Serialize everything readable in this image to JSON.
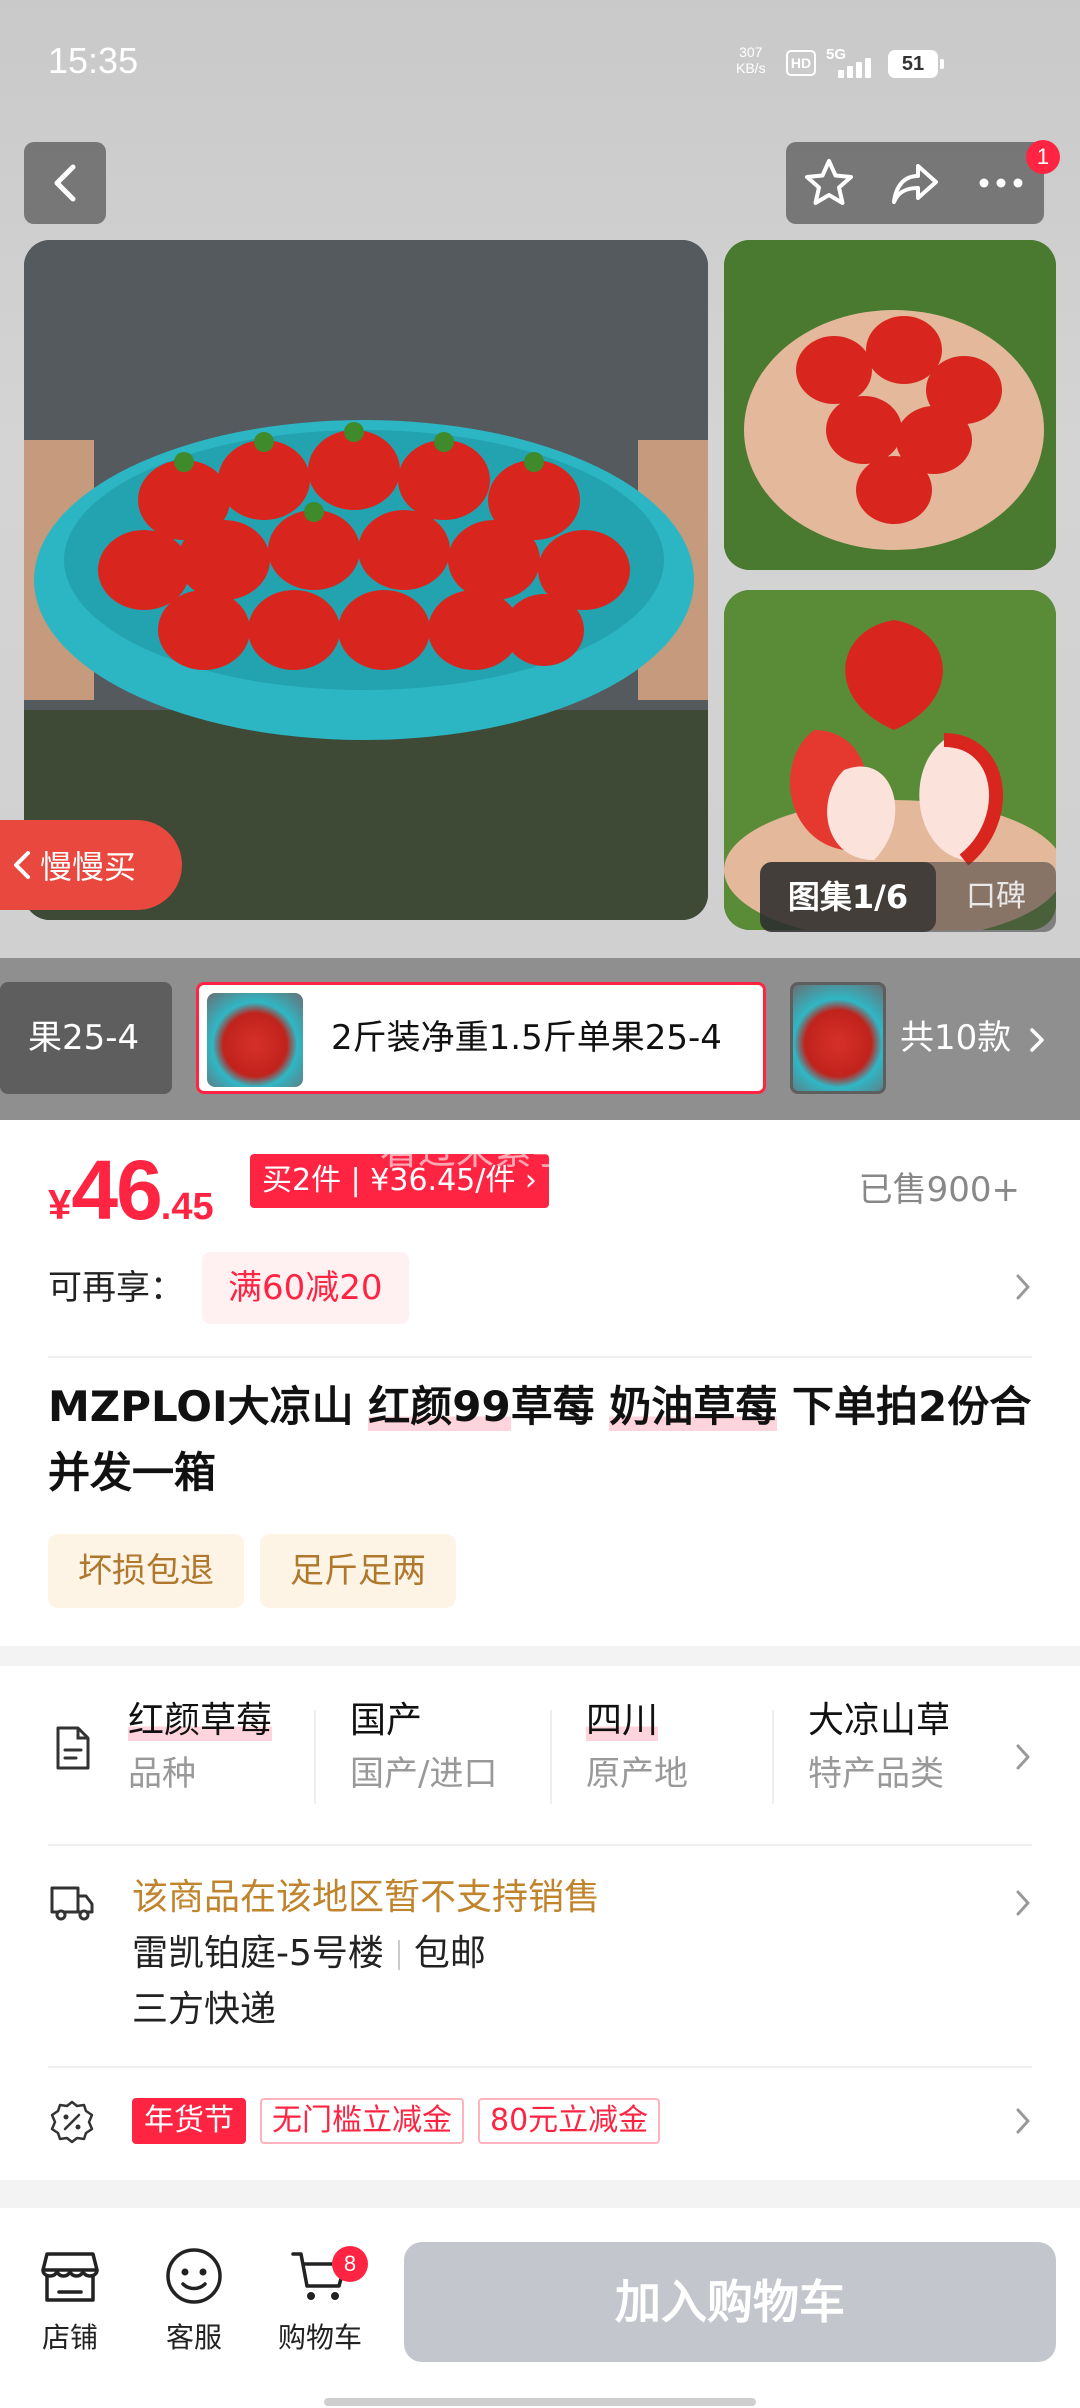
{
  "status_bar": {
    "time": "15:35",
    "net_speed_value": "307",
    "net_speed_unit": "KB/s",
    "hd": "HD",
    "network": "5G",
    "battery": "51"
  },
  "nav": {
    "more_badge": "1"
  },
  "gallery": {
    "counter": "图集1/6",
    "koubei": "口碑",
    "slow_buy": "慢慢买"
  },
  "variants": {
    "prev_label": "果25-4",
    "selected_label": "2斤装净重1.5斤单果25-4",
    "total": "共10款"
  },
  "price": {
    "currency": "¥",
    "integer": "46",
    "decimal": ".45",
    "promo": "买2件 | ¥36.45/件 ›",
    "watermark": "看过来紧手鼓",
    "sold": "已售900+"
  },
  "enjoy": {
    "label": "可再享：",
    "offer": "满60减20"
  },
  "title": {
    "part1": "MZPLOI大凉山 ",
    "hl1": "红颜99",
    "part2": "草莓 ",
    "hl2": "奶油草莓",
    "part3": "  下单拍2份合并发一箱"
  },
  "badges": [
    "坏损包退",
    "足斤足两"
  ],
  "specs": [
    {
      "value": "红颜草莓",
      "key": "品种"
    },
    {
      "value": "国产",
      "key": "国产/进口"
    },
    {
      "value": "四川",
      "key": "原产地"
    },
    {
      "value": "大凉山草",
      "key": "特产品类"
    }
  ],
  "shipping": {
    "warning": "该商品在该地区暂不支持销售",
    "address": "雷凯铂庭-5号楼",
    "free": "包邮",
    "express": "三方快递"
  },
  "coupons": [
    "年货节",
    "无门槛立减金",
    "80元立减金"
  ],
  "bottom": {
    "store": "店铺",
    "service": "客服",
    "cart": "购物车",
    "cart_badge": "8",
    "add_to_cart": "加入购物车"
  },
  "colors": {
    "accent": "#ff2442",
    "gold": "#c0842c",
    "disabled_button": "#c3c6cc"
  }
}
